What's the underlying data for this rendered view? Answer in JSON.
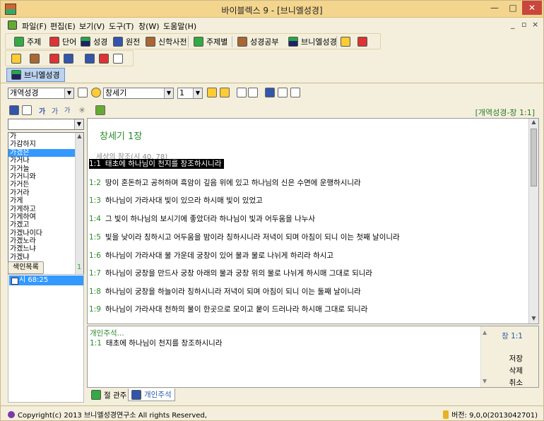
{
  "window": {
    "title": "바이블렉스 9 - [브니엘성경]",
    "controls": {
      "minimize": "—",
      "maximize": "□",
      "close": "✕"
    }
  },
  "menu": {
    "items": [
      "파일(F)",
      "편집(E)",
      "보기(V)",
      "도구(T)",
      "창(W)",
      "도움말(H)"
    ],
    "mdi": {
      "minimize": "_",
      "restore": "▫",
      "close": "×"
    }
  },
  "toolbar1": {
    "buttons": [
      "주제",
      "단어",
      "성경",
      "원전",
      "신학사전",
      "주제별",
      "성경공부",
      "브니엘성경"
    ]
  },
  "doc_tab": {
    "label": "브니엘성경"
  },
  "selectors": {
    "version": "개역성경",
    "book": "창세기",
    "chapter": "1"
  },
  "reference_label": "[개역성경-창 1:1]",
  "word_list": {
    "search_value": "",
    "items": [
      "가",
      "가감하지",
      "가겠은",
      "가거나",
      "가거늘",
      "가거니와",
      "가거든",
      "가거라",
      "가게",
      "가게하고",
      "가게하여",
      "가겠고",
      "가겠나이다",
      "가겠노라",
      "가겠느냐",
      "가겠냐"
    ],
    "selected_index": 2
  },
  "index_panel": {
    "button_label": "색인목록",
    "count": "1",
    "items": [
      "시 68:25"
    ]
  },
  "bible": {
    "chapter_title": "창세기 1장",
    "section_heading": "세상의 창조(시 40, 78)",
    "verses": [
      {
        "num": "1:1",
        "text": "태초에 하나님이 천지를 창조하시니라",
        "selected": true
      },
      {
        "num": "1:2",
        "text": "땅이 혼돈하고 공허하며 흑암이 깊음 위에 있고 하나님의 신은 수면에 운행하시니라"
      },
      {
        "num": "1:3",
        "text": "하나님이 가라사대 빛이 있으라 하시매 빛이 있었고"
      },
      {
        "num": "1:4",
        "text": "그 빛이 하나님의 보시기에 좋았더라 하나님이 빛과 어두움을 나누사"
      },
      {
        "num": "1:5",
        "text": "빛을 낮이라 칭하시고 어두움을 밤이라 칭하시니라 저녁이 되며 아침이 되니 이는 첫째 날이니라"
      },
      {
        "num": "1:6",
        "text": "하나님이 가라사대 물 가운데 궁창이 있어 물과 물로 나뉘게 하리라 하시고"
      },
      {
        "num": "1:7",
        "text": "하나님이 궁창을 만드사 궁창 아래의 물과 궁창 위의 물로 나뉘게 하시매 그대로 되니라"
      },
      {
        "num": "1:8",
        "text": "하나님이 궁창을 하늘이라 칭하시니라 저녁이 되며 아침이 되니 이는 둘째 날이니라"
      },
      {
        "num": "1:9",
        "text": "하나님이 가라사대 천하의 물이 한곳으로 모이고 뭍이 드러나라 하시매 그대로 되니라"
      }
    ]
  },
  "note": {
    "heading": "개인주석...",
    "verse_num": "1:1",
    "verse_text": "태초에 하나님이 천지를 창조하시니라",
    "ref": "창 1:1",
    "save": "저장",
    "delete": "삭제",
    "cancel": "취소"
  },
  "bottom_tabs": [
    "절 관주",
    "개인주석"
  ],
  "status": {
    "copyright": "Copyright(c) 2013 브니엘성경연구소 All rights Reserved,",
    "version": "버전: 9,0,0(2013042701)"
  }
}
